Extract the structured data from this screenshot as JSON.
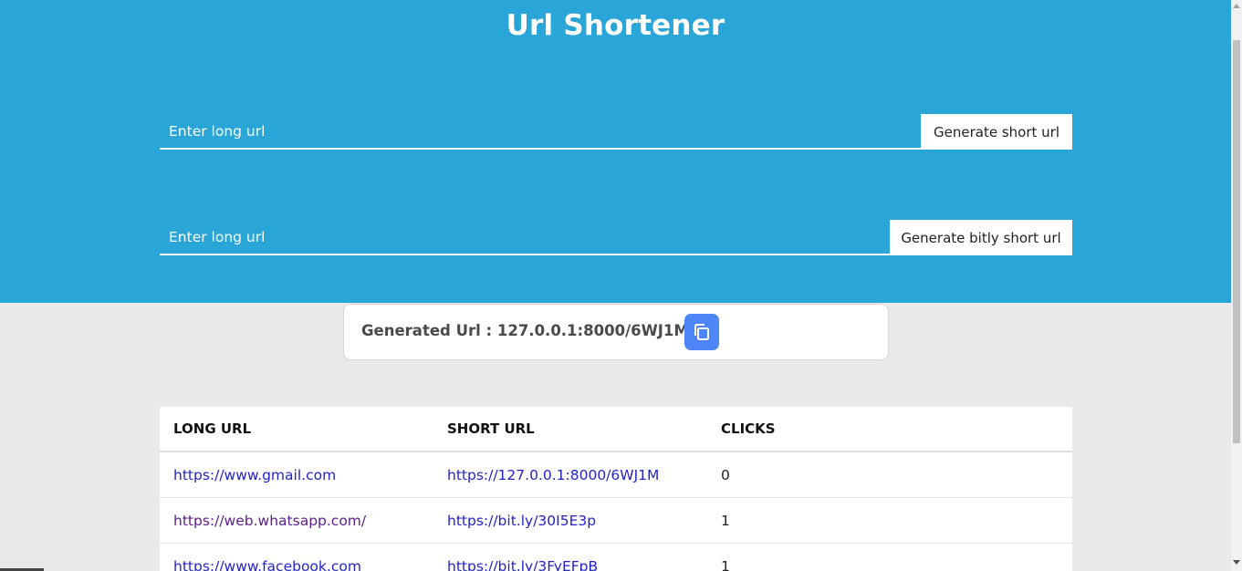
{
  "header": {
    "title": "Url Shortener"
  },
  "forms": [
    {
      "placeholder": "Enter long url",
      "button_label": "Generate short url"
    },
    {
      "placeholder": "Enter long url",
      "button_label": "Generate bitly short url"
    }
  ],
  "result": {
    "label": "Generated Url : 127.0.0.1:8000/6WJ1M",
    "copy_icon": "copy-icon"
  },
  "table": {
    "columns": [
      "LONG URL",
      "SHORT URL",
      "CLICKS"
    ],
    "rows": [
      {
        "long_url": "https://www.gmail.com",
        "short_url": "https://127.0.0.1:8000/6WJ1M",
        "clicks": "0"
      },
      {
        "long_url": "https://web.whatsapp.com/",
        "short_url": "https://bit.ly/30I5E3p",
        "clicks": "1"
      },
      {
        "long_url": "https://www.facebook.com",
        "short_url": "https://bit.ly/3FyEFpB",
        "clicks": "1"
      }
    ]
  },
  "colors": {
    "hero_bg": "#29a5d8",
    "page_bg": "#e9e9e9",
    "copy_button": "#4f86f7",
    "link": "#2323c8",
    "visited_link": "#5a1f8a"
  }
}
